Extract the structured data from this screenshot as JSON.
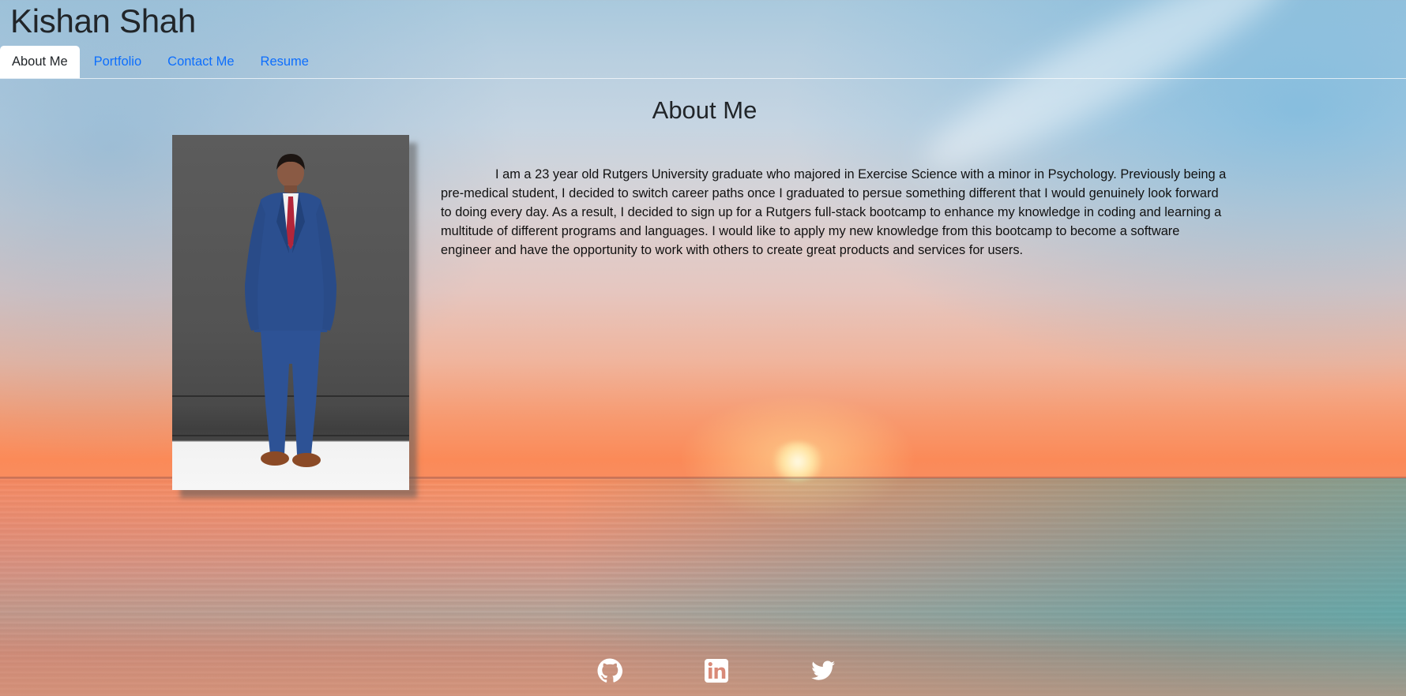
{
  "header": {
    "site_title": "Kishan Shah"
  },
  "nav": {
    "tabs": [
      {
        "label": "About Me",
        "active": true
      },
      {
        "label": "Portfolio",
        "active": false
      },
      {
        "label": "Contact Me",
        "active": false
      },
      {
        "label": "Resume",
        "active": false
      }
    ]
  },
  "main": {
    "heading": "About Me",
    "bio": "I am a 23 year old Rutgers University graduate who majored in Exercise Science with a minor in Psychology. Previously being a pre-medical student, I decided to switch career paths once I graduated to persue something different that I would genuinely look forward to doing every day. As a result, I decided to sign up for a Rutgers full-stack bootcamp to enhance my knowledge in coding and learning a multitude of different programs and languages. I would like to apply my new knowledge from this bootcamp to become a software engineer and have the opportunity to work with others to create great products and services for users."
  },
  "footer": {
    "social_icons": [
      "github-icon",
      "linkedin-icon",
      "twitter-icon"
    ]
  },
  "colors": {
    "link": "#0d6efd",
    "text": "#212529",
    "active_tab_bg": "#ffffff"
  }
}
